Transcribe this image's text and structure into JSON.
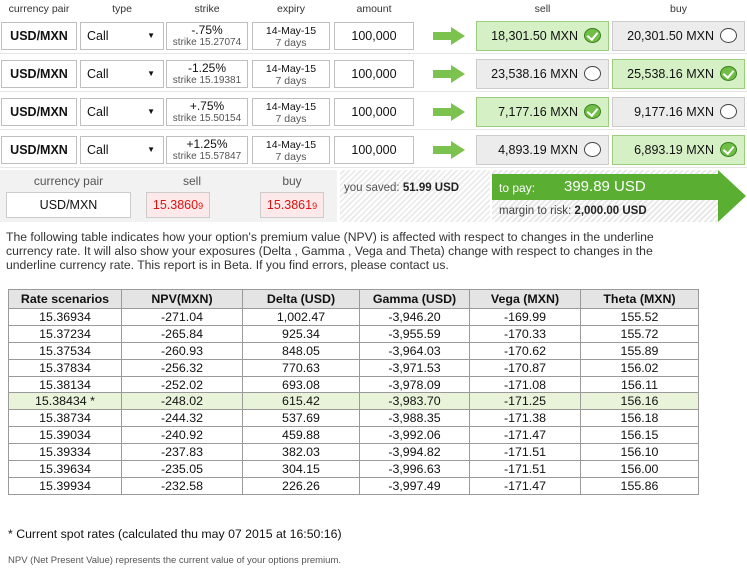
{
  "headers": [
    "currency pair",
    "type",
    "strike",
    "expiry",
    "amount",
    "sell",
    "buy"
  ],
  "legs": [
    {
      "pair": "USD/MXN",
      "type": "Call",
      "strike_pct": "-.75%",
      "strike_val": "strike 15.27074",
      "expiry_date": "14-May-15",
      "expiry_days": "7 days",
      "amount": "100,000",
      "sell": "18,301.50 MXN",
      "sell_checked": true,
      "buy": "20,301.50 MXN",
      "buy_checked": false
    },
    {
      "pair": "USD/MXN",
      "type": "Call",
      "strike_pct": "-1.25%",
      "strike_val": "strike 15.19381",
      "expiry_date": "14-May-15",
      "expiry_days": "7 days",
      "amount": "100,000",
      "sell": "23,538.16 MXN",
      "sell_checked": false,
      "buy": "25,538.16 MXN",
      "buy_checked": true
    },
    {
      "pair": "USD/MXN",
      "type": "Call",
      "strike_pct": "+.75%",
      "strike_val": "strike 15.50154",
      "expiry_date": "14-May-15",
      "expiry_days": "7 days",
      "amount": "100,000",
      "sell": "7,177.16 MXN",
      "sell_checked": true,
      "buy": "9,177.16 MXN",
      "buy_checked": false
    },
    {
      "pair": "USD/MXN",
      "type": "Call",
      "strike_pct": "+1.25%",
      "strike_val": "strike 15.57847",
      "expiry_date": "14-May-15",
      "expiry_days": "7 days",
      "amount": "100,000",
      "sell": "4,893.19 MXN",
      "sell_checked": false,
      "buy": "6,893.19 MXN",
      "buy_checked": true
    }
  ],
  "summary": {
    "pair_label": "currency pair",
    "sell_label": "sell",
    "buy_label": "buy",
    "pair": "USD/MXN",
    "sell_rate": "15.3860",
    "sell_rate_pip": "9",
    "buy_rate": "15.3861",
    "buy_rate_pip": "9",
    "saved_label": "you saved:",
    "saved_value": "51.99 USD",
    "pay_label": "to pay:",
    "pay_value": "399.89 USD",
    "margin_label": "margin to risk:",
    "margin_value": "2,000.00 USD"
  },
  "description": "The following table indicates how your option's premium value (NPV) is affected with respect to changes in the underline currency rate. It will also show your exposures (Delta , Gamma , Vega and Theta) change with respect to changes in the underline currency rate. This report is in Beta. If you find errors, please contact us.",
  "table": {
    "columns": [
      "Rate scenarios",
      "NPV(MXN)",
      "Delta (USD)",
      "Gamma (USD)",
      "Vega (MXN)",
      "Theta (MXN)"
    ],
    "rows": [
      [
        "15.36934",
        "-271.04",
        "1,002.47",
        "-3,946.20",
        "-169.99",
        "155.52"
      ],
      [
        "15.37234",
        "-265.84",
        "925.34",
        "-3,955.59",
        "-170.33",
        "155.72"
      ],
      [
        "15.37534",
        "-260.93",
        "848.05",
        "-3,964.03",
        "-170.62",
        "155.89"
      ],
      [
        "15.37834",
        "-256.32",
        "770.63",
        "-3,971.53",
        "-170.87",
        "156.02"
      ],
      [
        "15.38134",
        "-252.02",
        "693.08",
        "-3,978.09",
        "-171.08",
        "156.11"
      ],
      [
        "15.38434 *",
        "-248.02",
        "615.42",
        "-3,983.70",
        "-171.25",
        "156.16"
      ],
      [
        "15.38734",
        "-244.32",
        "537.69",
        "-3,988.35",
        "-171.38",
        "156.18"
      ],
      [
        "15.39034",
        "-240.92",
        "459.88",
        "-3,992.06",
        "-171.47",
        "156.15"
      ],
      [
        "15.39334",
        "-237.83",
        "382.03",
        "-3,994.82",
        "-171.51",
        "156.10"
      ],
      [
        "15.39634",
        "-235.05",
        "304.15",
        "-3,996.63",
        "-171.51",
        "156.00"
      ],
      [
        "15.39934",
        "-232.58",
        "226.26",
        "-3,997.49",
        "-171.47",
        "155.86"
      ]
    ],
    "spot_row_index": 5
  },
  "spot_note": "* Current spot rates (calculated thu may 07 2015 at 16:50:16)",
  "footer": "NPV (Net Present Value) represents the current value of your options premium.",
  "colors": {
    "accent_green": "#5aae32",
    "selected_bg": "#d6f0c5",
    "rate_red": "#dd1111"
  }
}
